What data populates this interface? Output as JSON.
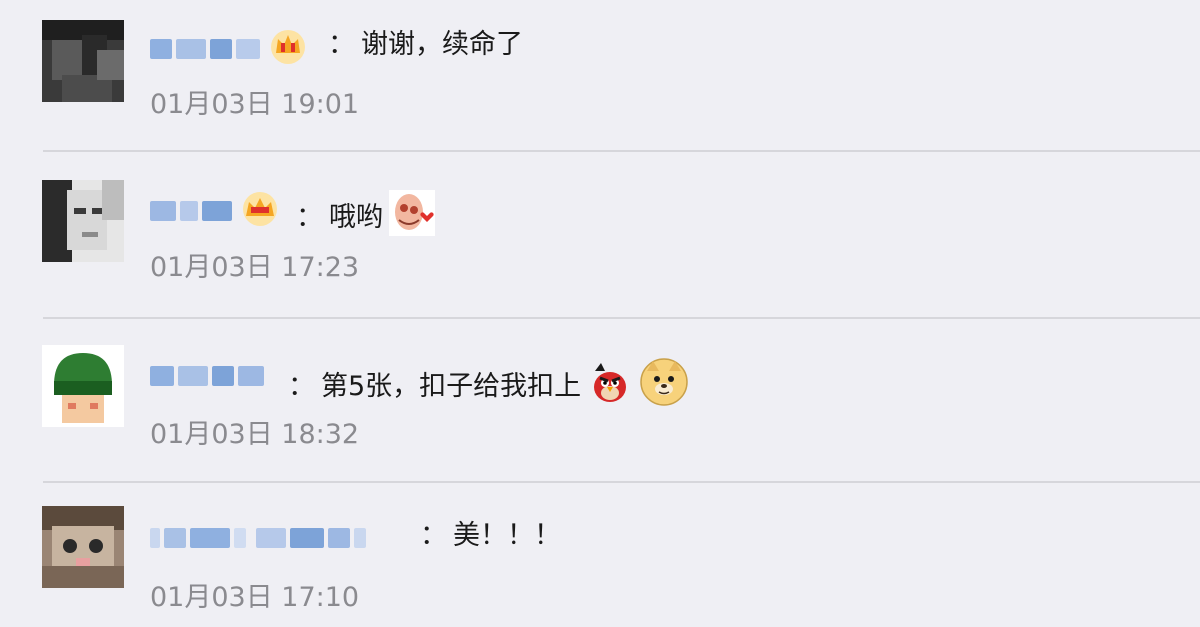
{
  "comments": [
    {
      "username_obscured": true,
      "has_vip_crown": true,
      "separator": "：",
      "text": "谢谢，续命了",
      "timestamp": "01月03日 19:01",
      "emojis": []
    },
    {
      "username_obscured": true,
      "has_vip_crown": true,
      "separator": "：",
      "text": "哦哟",
      "timestamp": "01月03日 17:23",
      "emojis": [
        "cartoon-sticker-icon"
      ]
    },
    {
      "username_obscured": true,
      "has_vip_crown": false,
      "separator": "：",
      "text": "第5张，扣子给我扣上",
      "timestamp": "01月03日 18:32",
      "emojis": [
        "angry-bird-icon",
        "doge-icon"
      ]
    },
    {
      "username_obscured": true,
      "has_vip_crown": false,
      "separator": "：",
      "text": "美！！！",
      "timestamp": "01月03日 17:10",
      "emojis": []
    }
  ],
  "colors": {
    "background": "#efeff4",
    "timestamp": "#8a8a8f",
    "username_blur": "#7da3d8",
    "crown": "#f5a623"
  }
}
